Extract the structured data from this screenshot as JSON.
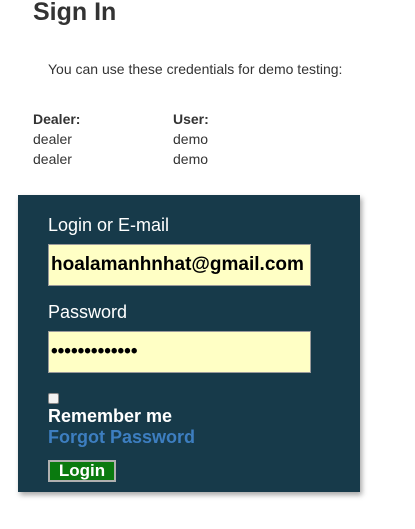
{
  "page": {
    "title": "Sign In",
    "intro": "You can use these credentials for demo testing:"
  },
  "credentials": {
    "dealer": {
      "header": "Dealer:",
      "values": [
        "dealer",
        "dealer"
      ]
    },
    "user": {
      "header": "User:",
      "values": [
        "demo",
        "demo"
      ]
    }
  },
  "login_form": {
    "login_label": "Login or E-mail",
    "login_value": "hoalamanhnhat@gmail.com",
    "password_label": "Password",
    "password_value": "•••••••••••••",
    "remember_label": "Remember me",
    "remember_checked": false,
    "forgot_label": "Forgot Password",
    "submit_label": "Login"
  },
  "colors": {
    "panel_bg": "#173a4a",
    "input_bg": "#ffffc5",
    "link": "#3d7ec0",
    "button_bg": "#0a7a0f"
  }
}
